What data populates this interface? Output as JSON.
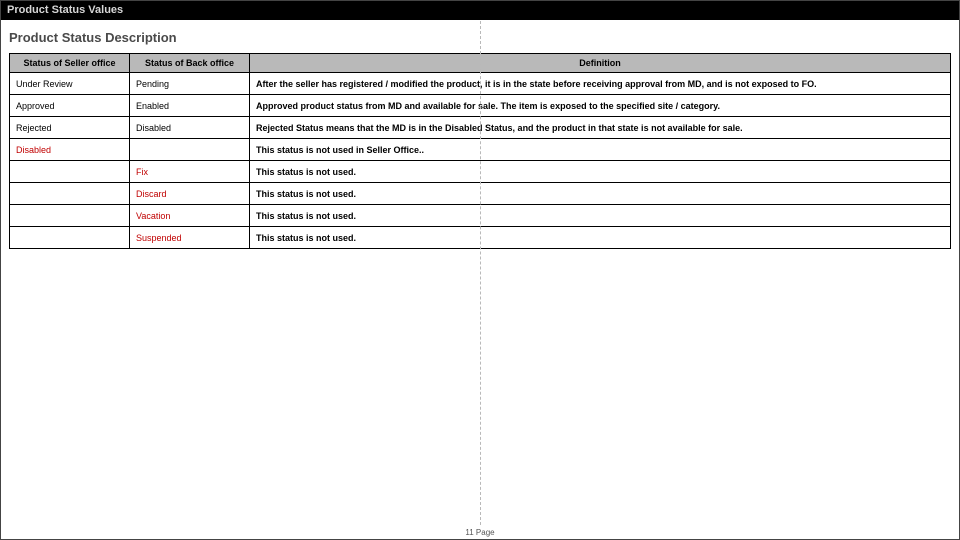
{
  "header": {
    "title_bar": "Product Status Values",
    "section_title": "Product Status Description"
  },
  "table": {
    "columns": {
      "seller": "Status of Seller office",
      "back": "Status of Back office",
      "definition": "Definition"
    },
    "rows": [
      {
        "seller": "Under Review",
        "seller_red": false,
        "back": "Pending",
        "back_red": false,
        "definition": "After the seller has registered / modified the product, it is in the state before receiving approval from MD, and is not exposed to FO."
      },
      {
        "seller": "Approved",
        "seller_red": false,
        "back": "Enabled",
        "back_red": false,
        "definition": "Approved product status from MD and available for sale. The item is exposed to the specified site / category."
      },
      {
        "seller": "Rejected",
        "seller_red": false,
        "back": "Disabled",
        "back_red": false,
        "definition": "Rejected Status means that the MD is in the Disabled Status, and the product in that state is not available for sale."
      },
      {
        "seller": "Disabled",
        "seller_red": true,
        "back": "",
        "back_red": false,
        "definition": "This status is not used in Seller Office.."
      },
      {
        "seller": "",
        "seller_red": false,
        "back": "Fix",
        "back_red": true,
        "definition": "This status is not used."
      },
      {
        "seller": "",
        "seller_red": false,
        "back": "Discard",
        "back_red": true,
        "definition": "This status is not used."
      },
      {
        "seller": "",
        "seller_red": false,
        "back": "Vacation",
        "back_red": true,
        "definition": "This status is not used."
      },
      {
        "seller": "",
        "seller_red": false,
        "back": "Suspended",
        "back_red": true,
        "definition": "This status is not used."
      }
    ]
  },
  "footer": {
    "page_label": "11 Page"
  }
}
